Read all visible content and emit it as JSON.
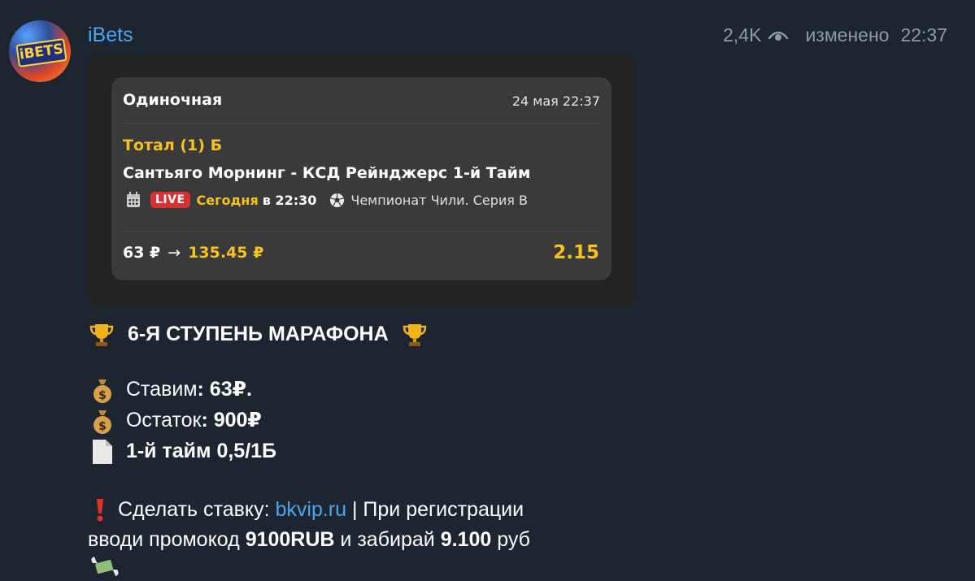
{
  "channel": {
    "name": "iBets",
    "avatar_text": "iBETS",
    "views": "2,4K",
    "edited_label": "изменено",
    "time": "22:37"
  },
  "bet_card": {
    "type": "Одиночная",
    "date": "24 мая 22:37",
    "bet_type": "Тотал (1) Б",
    "match": "Сантьяго Морнинг - КСД Рейнджерс 1-й Тайм",
    "live_label": "LIVE",
    "today_label": "Сегодня",
    "time_text": "в 22:30",
    "league": "Чемпионат Чили. Серия В",
    "stake": "63 ₽",
    "arrow": "→",
    "payout": "135.45 ₽",
    "odds": "2.15"
  },
  "message": {
    "title": "6-Я СТУПЕНЬ МАРАФОНА",
    "stake_label": "Ставим",
    "stake_value": ": 63₽.",
    "remainder_label": "Остаток",
    "remainder_value": ": 900₽",
    "bet_line": "1-й тайм 0,5/1Б",
    "cta_label": "Сделать ставку: ",
    "link": "bkvip.ru",
    "cta_rest": " | При регистрации",
    "line2_a": "вводи промокод ",
    "promo": "9100RUB",
    "line2_b": " и забирай ",
    "amount": "9.100",
    "line2_c": " руб"
  },
  "colors": {
    "background": "#1c2530",
    "accent_blue": "#4aa6ee",
    "gold": "#f7c21c",
    "live_red": "#d63232",
    "card_bg": "#3a3a3b"
  },
  "icons": [
    "eye-icon",
    "calendar-icon",
    "soccer-ball-icon",
    "trophy-icon",
    "money-bag-icon",
    "document-icon",
    "exclamation-icon",
    "money-wings-icon"
  ]
}
